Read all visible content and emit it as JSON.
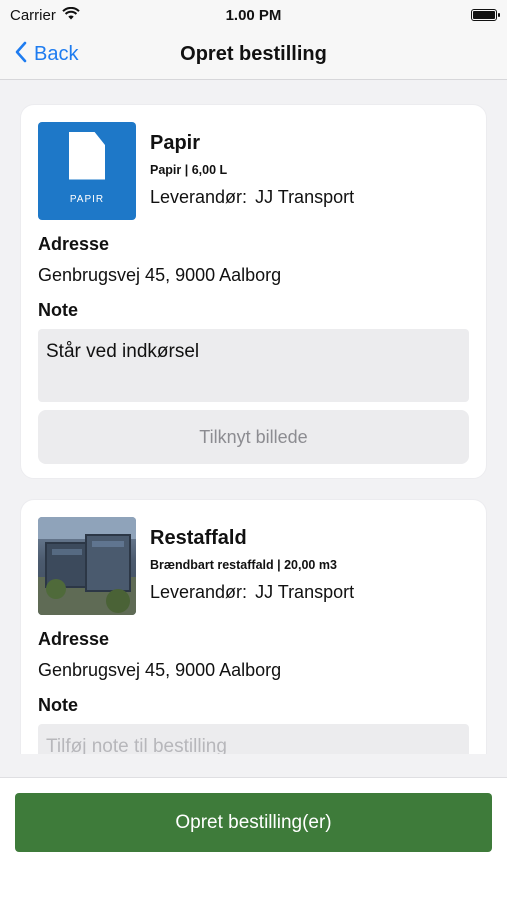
{
  "status": {
    "carrier": "Carrier",
    "time": "1.00 PM"
  },
  "nav": {
    "back_label": "Back",
    "title": "Opret bestilling"
  },
  "orders": [
    {
      "product_name": "Papir",
      "product_sub": "Papir | 6,00 L",
      "thumb_label": "PAPIR",
      "supplier_label": "Leverandør:",
      "supplier_value": "JJ Transport",
      "address_label": "Adresse",
      "address_value": "Genbrugsvej 45, 9000 Aalborg",
      "note_label": "Note",
      "note_value": "Står ved indkørsel",
      "attach_label": "Tilknyt billede"
    },
    {
      "product_name": "Restaffald",
      "product_sub": "Brændbart restaffald | 20,00 m3",
      "supplier_label": "Leverandør:",
      "supplier_value": "JJ Transport",
      "address_label": "Adresse",
      "address_value": "Genbrugsvej 45, 9000 Aalborg",
      "note_label": "Note",
      "note_placeholder": "Tilføj note til bestilling"
    }
  ],
  "footer": {
    "submit_label": "Opret bestilling(er)"
  },
  "colors": {
    "accent_blue": "#1e7cf0",
    "primary_green": "#3e7b3a",
    "papir_blue": "#1e78c8"
  },
  "icons": {
    "back": "chevron-left-icon",
    "wifi": "wifi-icon",
    "battery": "battery-icon",
    "papir": "document-icon"
  }
}
